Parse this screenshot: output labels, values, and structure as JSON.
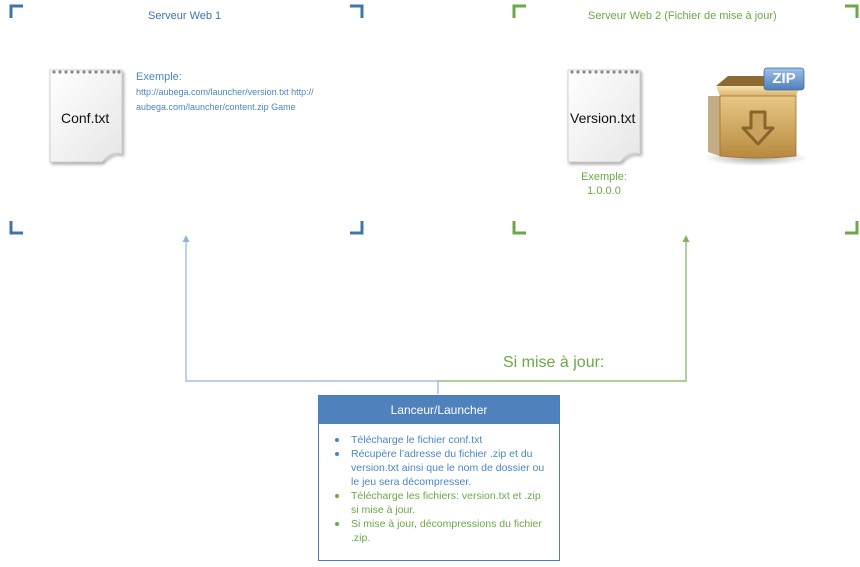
{
  "colors": {
    "server1_accent": "#3f74b0",
    "server2_accent": "#6aa945",
    "launcher_header_bg": "#4f81bd",
    "arrow_blue": "#8db3e2",
    "arrow_green": "#7cb45a"
  },
  "server1": {
    "title": "Serveur Web 1",
    "document": {
      "label": "Conf.txt",
      "icon": "text-document-icon"
    },
    "example": {
      "heading": "Exemple:",
      "line1": "http://aubega.com/launcher/version.txt http://",
      "line2": "aubega.com/launcher/content.zip Game"
    }
  },
  "server2": {
    "title": "Serveur Web 2 (Fichier de mise à jour)",
    "document": {
      "label": "Version.txt",
      "icon": "text-document-icon"
    },
    "zip": {
      "badge": "ZIP",
      "icon": "zip-archive-icon"
    },
    "example": {
      "heading": "Exemple:",
      "value": "1.0.0.0"
    }
  },
  "connector": {
    "update_label": "Si mise à jour:"
  },
  "launcher": {
    "title": "Lanceur/Launcher",
    "items": [
      {
        "text": "Télécharge le fichier conf.txt",
        "color": "blue"
      },
      {
        "text": "Récupère l’adresse du fichier .zip et du version.txt ainsi que le nom de dossier ou le jeu sera décompresser.",
        "color": "blue"
      },
      {
        "text": "Télécharge les fichiers: version.txt et .zip si mise  à jour.",
        "color": "green"
      },
      {
        "text": "Si mise à jour, décompressions du fichier .zip.",
        "color": "green"
      }
    ]
  }
}
